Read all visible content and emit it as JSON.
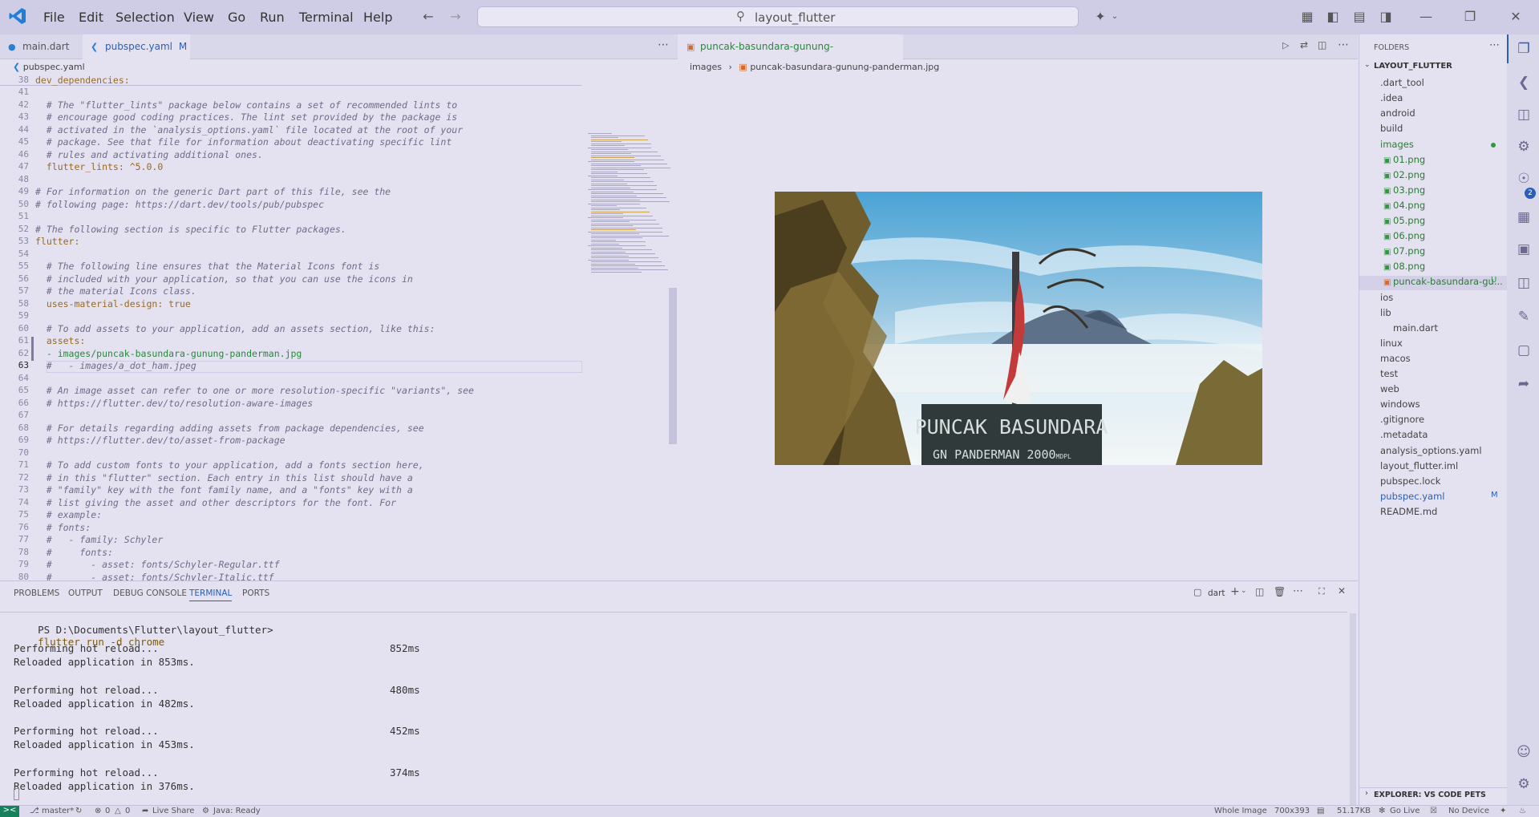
{
  "titlebar": {
    "menus": [
      "File",
      "Edit",
      "Selection",
      "View",
      "Go",
      "Run",
      "Terminal",
      "Help"
    ],
    "search": "layout_flutter"
  },
  "tabs_left": [
    {
      "label": "main.dart",
      "badge": ""
    },
    {
      "label": "pubspec.yaml",
      "badge": "M"
    }
  ],
  "breadcrumb_left": "pubspec.yaml",
  "tabs_right": [
    {
      "label": "puncak-basundara-gunung-panderman.jpg",
      "badge": "U"
    }
  ],
  "breadcrumb_right": [
    "images",
    "puncak-basundara-gunung-panderman.jpg"
  ],
  "code_lines": [
    {
      "n": "38",
      "t": "dev_dependencies:",
      "k": "key"
    },
    {
      "n": "41",
      "t": "",
      "k": ""
    },
    {
      "n": "42",
      "t": "  # The \"flutter_lints\" package below contains a set of recommended lints to",
      "k": ""
    },
    {
      "n": "43",
      "t": "  # encourage good coding practices. The lint set provided by the package is",
      "k": ""
    },
    {
      "n": "44",
      "t": "  # activated in the `analysis_options.yaml` file located at the root of your",
      "k": ""
    },
    {
      "n": "45",
      "t": "  # package. See that file for information about deactivating specific lint",
      "k": ""
    },
    {
      "n": "46",
      "t": "  # rules and activating additional ones.",
      "k": ""
    },
    {
      "n": "47",
      "t": "  flutter_lints: ^5.0.0",
      "k": "key"
    },
    {
      "n": "48",
      "t": "",
      "k": ""
    },
    {
      "n": "49",
      "t": "# For information on the generic Dart part of this file, see the",
      "k": ""
    },
    {
      "n": "50",
      "t": "# following page: https://dart.dev/tools/pub/pubspec",
      "k": ""
    },
    {
      "n": "51",
      "t": "",
      "k": ""
    },
    {
      "n": "52",
      "t": "# The following section is specific to Flutter packages.",
      "k": ""
    },
    {
      "n": "53",
      "t": "flutter:",
      "k": "key"
    },
    {
      "n": "54",
      "t": "",
      "k": ""
    },
    {
      "n": "55",
      "t": "  # The following line ensures that the Material Icons font is",
      "k": ""
    },
    {
      "n": "56",
      "t": "  # included with your application, so that you can use the icons in",
      "k": ""
    },
    {
      "n": "57",
      "t": "  # the material Icons class.",
      "k": ""
    },
    {
      "n": "58",
      "t": "  uses-material-design: true",
      "k": "key"
    },
    {
      "n": "59",
      "t": "",
      "k": ""
    },
    {
      "n": "60",
      "t": "  # To add assets to your application, add an assets section, like this:",
      "k": ""
    },
    {
      "n": "61",
      "t": "  assets:",
      "k": "key"
    },
    {
      "n": "62",
      "t": "  - images/puncak-basundara-gunung-panderman.jpg",
      "k": "grn"
    },
    {
      "n": "63",
      "t": "  #   - images/a_dot_ham.jpeg",
      "k": ""
    },
    {
      "n": "64",
      "t": "",
      "k": ""
    },
    {
      "n": "65",
      "t": "  # An image asset can refer to one or more resolution-specific \"variants\", see",
      "k": ""
    },
    {
      "n": "66",
      "t": "  # https://flutter.dev/to/resolution-aware-images",
      "k": ""
    },
    {
      "n": "67",
      "t": "",
      "k": ""
    },
    {
      "n": "68",
      "t": "  # For details regarding adding assets from package dependencies, see",
      "k": ""
    },
    {
      "n": "69",
      "t": "  # https://flutter.dev/to/asset-from-package",
      "k": ""
    },
    {
      "n": "70",
      "t": "",
      "k": ""
    },
    {
      "n": "71",
      "t": "  # To add custom fonts to your application, add a fonts section here,",
      "k": ""
    },
    {
      "n": "72",
      "t": "  # in this \"flutter\" section. Each entry in this list should have a",
      "k": ""
    },
    {
      "n": "73",
      "t": "  # \"family\" key with the font family name, and a \"fonts\" key with a",
      "k": ""
    },
    {
      "n": "74",
      "t": "  # list giving the asset and other descriptors for the font. For",
      "k": ""
    },
    {
      "n": "75",
      "t": "  # example:",
      "k": ""
    },
    {
      "n": "76",
      "t": "  # fonts:",
      "k": ""
    },
    {
      "n": "77",
      "t": "  #   - family: Schyler",
      "k": ""
    },
    {
      "n": "78",
      "t": "  #     fonts:",
      "k": ""
    },
    {
      "n": "79",
      "t": "  #       - asset: fonts/Schyler-Regular.ttf",
      "k": ""
    },
    {
      "n": "80",
      "t": "  #       - asset: fonts/Schyler-Italic.ttf",
      "k": ""
    }
  ],
  "photo_sign": {
    "line1": "PUNCAK BASUNDARA",
    "line2": "GN PANDERMAN 2000",
    "line2_unit": "MDPL"
  },
  "panel": {
    "tabs": [
      "PROBLEMS",
      "OUTPUT",
      "DEBUG CONSOLE",
      "TERMINAL",
      "PORTS"
    ],
    "active_tab": "TERMINAL",
    "terminal_profile": "dart",
    "prompt": "PS D:\\Documents\\Flutter\\layout_flutter>",
    "command": "flutter run -d chrome",
    "reloads": [
      {
        "line": "Performing hot reload...",
        "ms": "852ms",
        "done": "Reloaded application in 853ms."
      },
      {
        "line": "Performing hot reload...",
        "ms": "480ms",
        "done": "Reloaded application in 482ms."
      },
      {
        "line": "Performing hot reload...",
        "ms": "452ms",
        "done": "Reloaded application in 453ms."
      },
      {
        "line": "Performing hot reload...",
        "ms": "374ms",
        "done": "Reloaded application in 376ms."
      }
    ]
  },
  "explorer": {
    "header": "FOLDERS",
    "root": "LAYOUT_FLUTTER",
    "items": [
      {
        "label": ".dart_tool",
        "depth": 0,
        "badge": ""
      },
      {
        "label": ".idea",
        "depth": 0,
        "badge": ""
      },
      {
        "label": "android",
        "depth": 0,
        "badge": ""
      },
      {
        "label": "build",
        "depth": 0,
        "badge": ""
      },
      {
        "label": "images",
        "depth": 0,
        "badge": ""
      },
      {
        "label": "01.png",
        "depth": 1,
        "badge": ""
      },
      {
        "label": "02.png",
        "depth": 1,
        "badge": ""
      },
      {
        "label": "03.png",
        "depth": 1,
        "badge": ""
      },
      {
        "label": "04.png",
        "depth": 1,
        "badge": ""
      },
      {
        "label": "05.png",
        "depth": 1,
        "badge": ""
      },
      {
        "label": "06.png",
        "depth": 1,
        "badge": ""
      },
      {
        "label": "07.png",
        "depth": 1,
        "badge": ""
      },
      {
        "label": "08.png",
        "depth": 1,
        "badge": ""
      },
      {
        "label": "puncak-basundara-gu...",
        "depth": 1,
        "badge": "U"
      },
      {
        "label": "ios",
        "depth": 0,
        "badge": ""
      },
      {
        "label": "lib",
        "depth": 0,
        "badge": ""
      },
      {
        "label": "main.dart",
        "depth": 1,
        "badge": ""
      },
      {
        "label": "linux",
        "depth": 0,
        "badge": ""
      },
      {
        "label": "macos",
        "depth": 0,
        "badge": ""
      },
      {
        "label": "test",
        "depth": 0,
        "badge": ""
      },
      {
        "label": "web",
        "depth": 0,
        "badge": ""
      },
      {
        "label": "windows",
        "depth": 0,
        "badge": ""
      },
      {
        "label": ".gitignore",
        "depth": 0,
        "badge": ""
      },
      {
        "label": ".metadata",
        "depth": 0,
        "badge": ""
      },
      {
        "label": "analysis_options.yaml",
        "depth": 0,
        "badge": ""
      },
      {
        "label": "layout_flutter.iml",
        "depth": 0,
        "badge": ""
      },
      {
        "label": "pubspec.lock",
        "depth": 0,
        "badge": ""
      },
      {
        "label": "pubspec.yaml",
        "depth": 0,
        "badge": "M"
      },
      {
        "label": "README.md",
        "depth": 0,
        "badge": ""
      }
    ],
    "footer": "EXPLORER: VS CODE PETS",
    "source_control_count": "2"
  },
  "status": {
    "branch": "master*",
    "errors": "0",
    "warnings": "0",
    "live_share": "Live Share",
    "java": "Java: Ready",
    "image_mode": "Whole Image",
    "dimensions": "700x393",
    "size": "51.17KB",
    "golive": "Go Live",
    "device": "No Device"
  },
  "colors": {
    "accent": "#2a7fd4",
    "git_green": "#2e9a3e",
    "git_modified": "#2a5fb5",
    "status_remote": "#16825d"
  }
}
